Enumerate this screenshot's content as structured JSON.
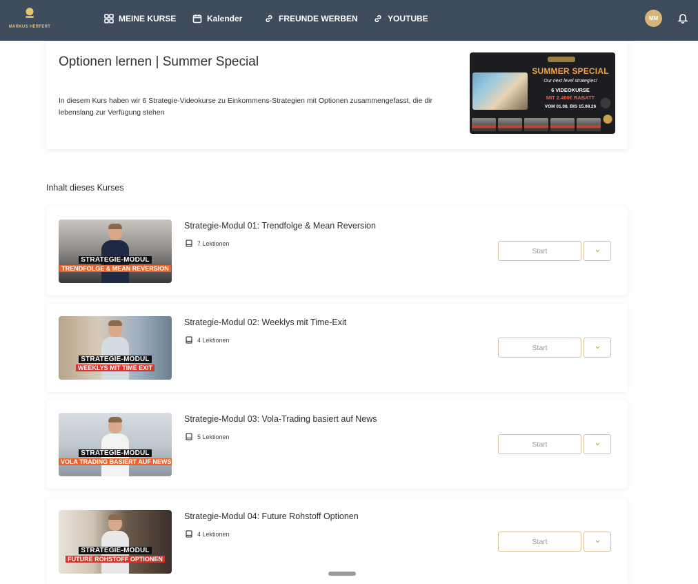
{
  "brand": {
    "logo_text": "MARKUS HERFERT"
  },
  "nav": [
    {
      "label": "MEINE KURSE",
      "icon": "grid-icon"
    },
    {
      "label": "Kalender",
      "icon": "calendar-icon"
    },
    {
      "label": "FREUNDE WERBEN",
      "icon": "link-icon"
    },
    {
      "label": "YOUTUBE",
      "icon": "link-icon"
    }
  ],
  "user": {
    "initials": "MM"
  },
  "course": {
    "title": "Optionen lernen | Summer Special",
    "description": "In diesem Kurs haben wir 6 Strategie-Videokurse zu Einkommens-Strategien mit Optionen zusammengefasst, die dir lebenslang zur Verfügung stehen",
    "banner": {
      "headline": "SUMMER SPECIAL",
      "script": "Our next level strategies!",
      "videos": "6 VIDEOKURSE",
      "discount": "MIT 2.400€ RABATT",
      "dates": "VOM 01.08. BIS 15.08.26"
    }
  },
  "section_title": "Inhalt dieses Kurses",
  "modules": [
    {
      "title": "Strategie-Modul 01: Trendfolge & Mean Reversion",
      "lessons": "7 Lektionen",
      "thumb_top": "STRATEGIE-MODUL",
      "thumb_bottom": "TRENDFOLGE & MEAN REVERSION",
      "start": "Start"
    },
    {
      "title": "Strategie-Modul 02: Weeklys mit Time-Exit",
      "lessons": "4 Lektionen",
      "thumb_top": "STRATEGIE-MODUL",
      "thumb_bottom": "WEEKLYS MIT TIME EXIT",
      "start": "Start"
    },
    {
      "title": "Strategie-Modul 03: Vola-Trading basiert auf News",
      "lessons": "5 Lektionen",
      "thumb_top": "STRATEGIE-MODUL",
      "thumb_bottom": "VOLA TRADING BASIERT AUF NEWS",
      "start": "Start"
    },
    {
      "title": "Strategie-Modul 04: Future Rohstoff Optionen",
      "lessons": "4 Lektionen",
      "thumb_top": "STRATEGIE-MODUL",
      "thumb_bottom": "FUTURE ROHSTOFF OPTIONEN",
      "start": "Start"
    }
  ],
  "colors": {
    "nav_bg": "#3d4b5c",
    "accent_gold": "#d5c19b",
    "label_orange": "#e8642c",
    "label_red": "#d9342b"
  }
}
